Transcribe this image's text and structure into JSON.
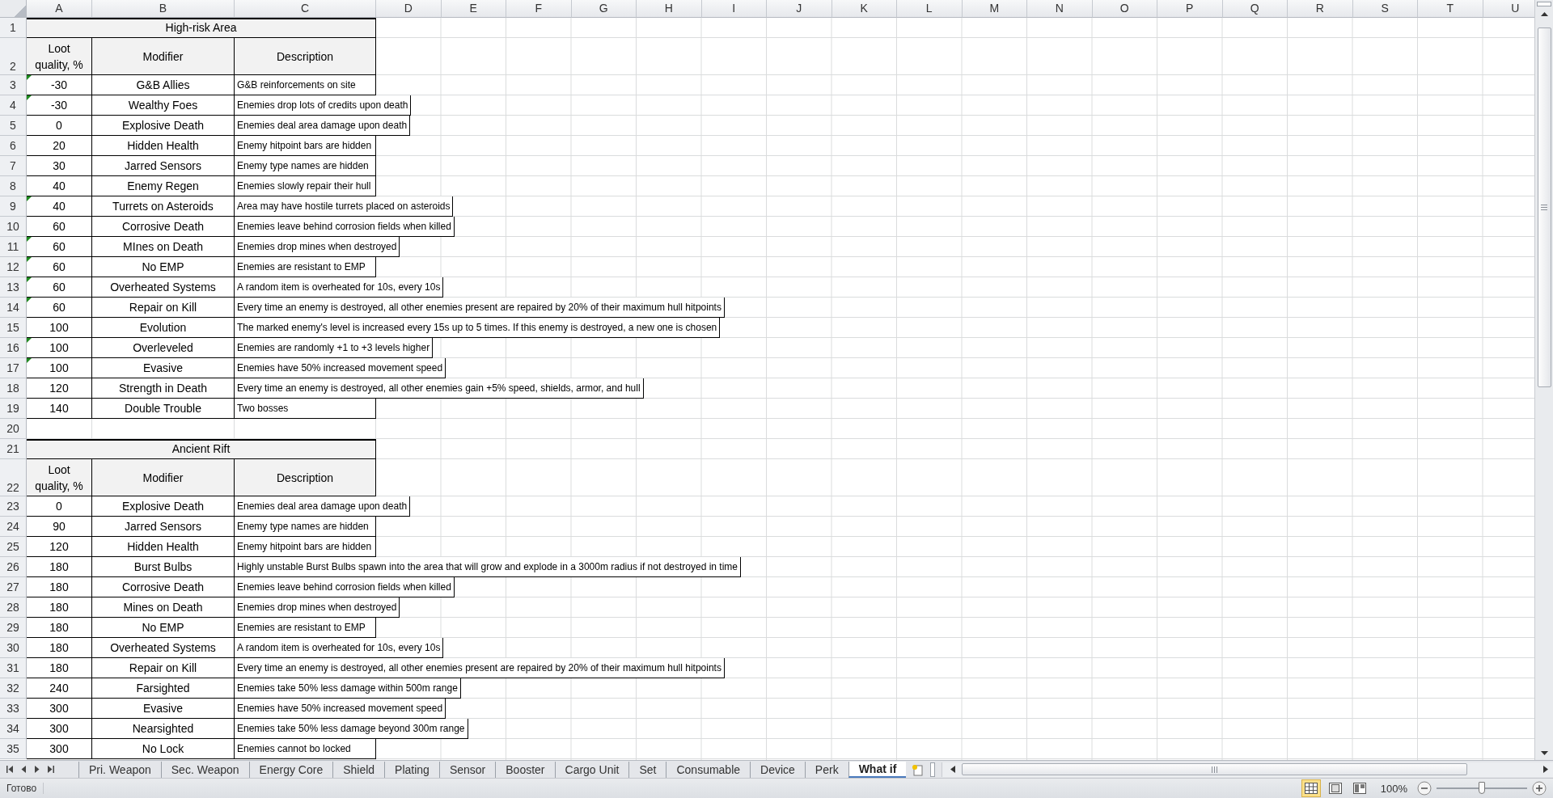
{
  "columns": [
    "A",
    "B",
    "C",
    "D",
    "E",
    "F",
    "G",
    "H",
    "I",
    "J",
    "K",
    "L",
    "M",
    "N",
    "O",
    "P",
    "Q",
    "R",
    "S",
    "T",
    "U"
  ],
  "rows": [
    {
      "kind": "title",
      "number": "1",
      "text": "High-risk Area"
    },
    {
      "kind": "header",
      "number": "2",
      "cells": [
        "Loot quality, %",
        "Modifier",
        "Description"
      ]
    },
    {
      "kind": "data",
      "number": "3",
      "warning": true,
      "cells": [
        "-30",
        "G&B Allies",
        "G&B reinforcements on site"
      ]
    },
    {
      "kind": "data",
      "number": "4",
      "warning": true,
      "cells": [
        "-30",
        "Wealthy Foes",
        "Enemies drop lots of credits upon death"
      ]
    },
    {
      "kind": "data",
      "number": "5",
      "warning": false,
      "cells": [
        "0",
        "Explosive Death",
        "Enemies deal area damage upon death"
      ]
    },
    {
      "kind": "data",
      "number": "6",
      "warning": false,
      "cells": [
        "20",
        "Hidden Health",
        "Enemy hitpoint bars are hidden"
      ]
    },
    {
      "kind": "data",
      "number": "7",
      "warning": false,
      "cells": [
        "30",
        "Jarred Sensors",
        "Enemy type names are hidden"
      ]
    },
    {
      "kind": "data",
      "number": "8",
      "warning": false,
      "cells": [
        "40",
        "Enemy Regen",
        "Enemies slowly repair their hull"
      ]
    },
    {
      "kind": "data",
      "number": "9",
      "warning": true,
      "cells": [
        "40",
        "Turrets on Asteroids",
        "Area may have hostile turrets placed on asteroids"
      ]
    },
    {
      "kind": "data",
      "number": "10",
      "warning": false,
      "cells": [
        "60",
        "Corrosive Death",
        "Enemies leave behind corrosion fields when killed"
      ]
    },
    {
      "kind": "data",
      "number": "11",
      "warning": true,
      "cells": [
        "60",
        "MInes on Death",
        "Enemies drop mines when destroyed"
      ]
    },
    {
      "kind": "data",
      "number": "12",
      "warning": true,
      "cells": [
        "60",
        "No EMP",
        "Enemies are resistant to EMP"
      ]
    },
    {
      "kind": "data",
      "number": "13",
      "warning": true,
      "cells": [
        "60",
        "Overheated Systems",
        "A random item is overheated for 10s, every 10s"
      ]
    },
    {
      "kind": "data",
      "number": "14",
      "warning": true,
      "cells": [
        "60",
        "Repair on Kill",
        "Every time an enemy is destroyed, all other enemies present are repaired by 20% of their maximum hull hitpoints"
      ]
    },
    {
      "kind": "data",
      "number": "15",
      "warning": false,
      "cells": [
        "100",
        "Evolution",
        "The marked enemy's level is increased every 15s up to 5 times. If this enemy is destroyed, a new one is chosen"
      ]
    },
    {
      "kind": "data",
      "number": "16",
      "warning": true,
      "cells": [
        "100",
        "Overleveled",
        "Enemies are randomly +1 to +3 levels higher"
      ]
    },
    {
      "kind": "data",
      "number": "17",
      "warning": true,
      "cells": [
        "100",
        "Evasive",
        "Enemies have 50% increased movement speed"
      ]
    },
    {
      "kind": "data",
      "number": "18",
      "warning": false,
      "cells": [
        "120",
        "Strength in Death",
        "Every time an enemy is destroyed, all other enemies gain +5% speed, shields, armor, and hull"
      ]
    },
    {
      "kind": "data",
      "number": "19",
      "warning": false,
      "cells": [
        "140",
        "Double Trouble",
        "Two bosses"
      ]
    },
    {
      "kind": "blank",
      "number": "20"
    },
    {
      "kind": "title",
      "number": "21",
      "text": "Ancient Rift"
    },
    {
      "kind": "header",
      "number": "22",
      "cells": [
        "Loot quality, %",
        "Modifier",
        "Description"
      ]
    },
    {
      "kind": "data",
      "number": "23",
      "warning": false,
      "cells": [
        "0",
        "Explosive Death",
        "Enemies deal area damage upon death"
      ]
    },
    {
      "kind": "data",
      "number": "24",
      "warning": false,
      "cells": [
        "90",
        "Jarred Sensors",
        "Enemy type names are hidden"
      ]
    },
    {
      "kind": "data",
      "number": "25",
      "warning": false,
      "cells": [
        "120",
        "Hidden Health",
        "Enemy hitpoint bars are hidden"
      ]
    },
    {
      "kind": "data",
      "number": "26",
      "warning": false,
      "cells": [
        "180",
        "Burst Bulbs",
        "Highly unstable Burst Bulbs spawn into the area that will grow and explode in a 3000m radius if not destroyed in time"
      ]
    },
    {
      "kind": "data",
      "number": "27",
      "warning": false,
      "cells": [
        "180",
        "Corrosive Death",
        "Enemies leave behind corrosion fields when killed"
      ]
    },
    {
      "kind": "data",
      "number": "28",
      "warning": false,
      "cells": [
        "180",
        "Mines on Death",
        "Enemies drop mines when destroyed"
      ]
    },
    {
      "kind": "data",
      "number": "29",
      "warning": false,
      "cells": [
        "180",
        "No EMP",
        "Enemies are resistant to EMP"
      ]
    },
    {
      "kind": "data",
      "number": "30",
      "warning": false,
      "cells": [
        "180",
        "Overheated Systems",
        "A random item is overheated for 10s, every 10s"
      ]
    },
    {
      "kind": "data",
      "number": "31",
      "warning": false,
      "cells": [
        "180",
        "Repair on Kill",
        "Every time an enemy is destroyed, all other enemies present are repaired by 20% of their maximum hull hitpoints"
      ]
    },
    {
      "kind": "data",
      "number": "32",
      "warning": false,
      "cells": [
        "240",
        "Farsighted",
        "Enemies take 50% less damage within 500m range"
      ]
    },
    {
      "kind": "data",
      "number": "33",
      "warning": false,
      "cells": [
        "300",
        "Evasive",
        "Enemies have 50% increased movement speed"
      ]
    },
    {
      "kind": "data",
      "number": "34",
      "warning": false,
      "cells": [
        "300",
        "Nearsighted",
        "Enemies take 50% less damage beyond 300m range"
      ]
    },
    {
      "kind": "data",
      "number": "35",
      "warning": false,
      "cells": [
        "300",
        "No Lock",
        "Enemies cannot bo locked"
      ]
    }
  ],
  "sheet_tabs": [
    {
      "label": "Pri. Weapon",
      "selected": false
    },
    {
      "label": "Sec. Weapon",
      "selected": false
    },
    {
      "label": "Energy Core",
      "selected": false
    },
    {
      "label": "Shield",
      "selected": false
    },
    {
      "label": "Plating",
      "selected": false
    },
    {
      "label": "Sensor",
      "selected": false
    },
    {
      "label": "Booster",
      "selected": false
    },
    {
      "label": "Cargo Unit",
      "selected": false
    },
    {
      "label": "Set",
      "selected": false
    },
    {
      "label": "Consumable",
      "selected": false
    },
    {
      "label": "Device",
      "selected": false
    },
    {
      "label": "Perk",
      "selected": false
    },
    {
      "label": "What if",
      "selected": true
    }
  ],
  "status": "Готово",
  "view_buttons": [
    {
      "kind": "normal",
      "selected": true
    },
    {
      "kind": "page-layout",
      "selected": false
    },
    {
      "kind": "page-break",
      "selected": false
    }
  ],
  "zoom": {
    "reading": "100%",
    "level": 0.5
  }
}
